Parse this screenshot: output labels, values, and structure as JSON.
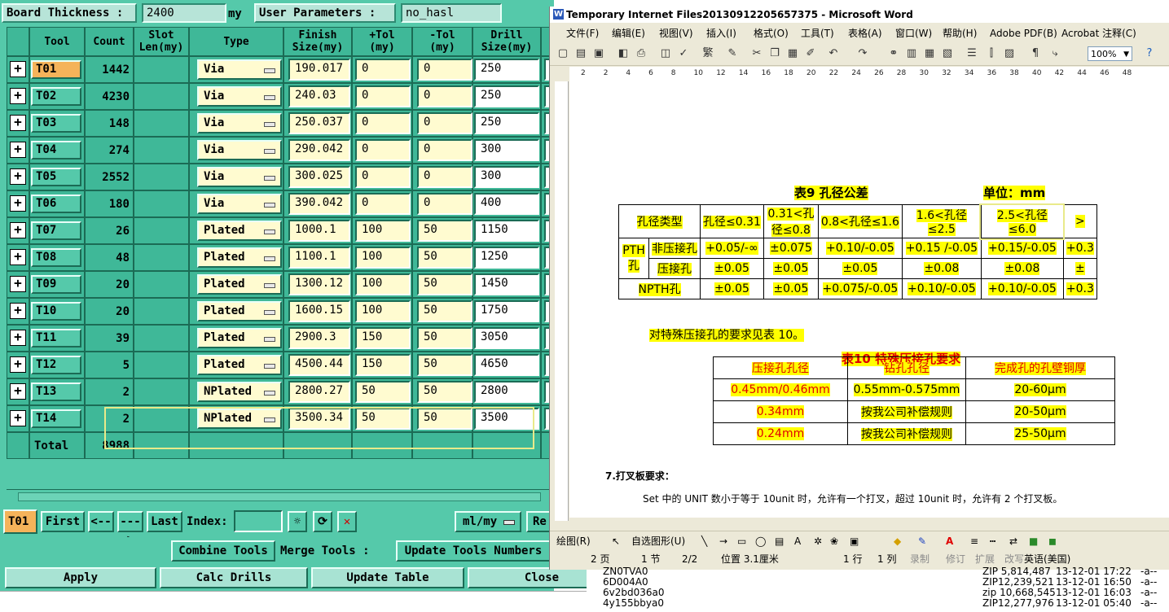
{
  "tool_app": {
    "board_thickness_label": "Board Thickness :",
    "board_thickness_value": "2400",
    "board_thickness_unit": "my",
    "user_params_label": "User Parameters :",
    "user_params_value": "no_hasl",
    "columns": [
      "Tool",
      "Count",
      "Slot\nLen(my)",
      "Type",
      "Finish\nSize(my)",
      "+Tol\n(my)",
      "-Tol\n(my)",
      "Drill\nSize(my)"
    ],
    "rows": [
      {
        "tool": "T01",
        "count": "1442",
        "type": "Via",
        "finish": "190.017",
        "ptol": "0",
        "mtol": "0",
        "drill": "250"
      },
      {
        "tool": "T02",
        "count": "4230",
        "type": "Via",
        "finish": "240.03",
        "ptol": "0",
        "mtol": "0",
        "drill": "250"
      },
      {
        "tool": "T03",
        "count": "148",
        "type": "Via",
        "finish": "250.037",
        "ptol": "0",
        "mtol": "0",
        "drill": "250"
      },
      {
        "tool": "T04",
        "count": "274",
        "type": "Via",
        "finish": "290.042",
        "ptol": "0",
        "mtol": "0",
        "drill": "300"
      },
      {
        "tool": "T05",
        "count": "2552",
        "type": "Via",
        "finish": "300.025",
        "ptol": "0",
        "mtol": "0",
        "drill": "300"
      },
      {
        "tool": "T06",
        "count": "180",
        "type": "Via",
        "finish": "390.042",
        "ptol": "0",
        "mtol": "0",
        "drill": "400"
      },
      {
        "tool": "T07",
        "count": "26",
        "type": "Plated",
        "finish": "1000.1",
        "ptol": "100",
        "mtol": "50",
        "drill": "1150"
      },
      {
        "tool": "T08",
        "count": "48",
        "type": "Plated",
        "finish": "1100.1",
        "ptol": "100",
        "mtol": "50",
        "drill": "1250"
      },
      {
        "tool": "T09",
        "count": "20",
        "type": "Plated",
        "finish": "1300.12",
        "ptol": "100",
        "mtol": "50",
        "drill": "1450"
      },
      {
        "tool": "T10",
        "count": "20",
        "type": "Plated",
        "finish": "1600.15",
        "ptol": "100",
        "mtol": "50",
        "drill": "1750"
      },
      {
        "tool": "T11",
        "count": "39",
        "type": "Plated",
        "finish": "2900.3",
        "ptol": "150",
        "mtol": "50",
        "drill": "3050"
      },
      {
        "tool": "T12",
        "count": "5",
        "type": "Plated",
        "finish": "4500.44",
        "ptol": "150",
        "mtol": "50",
        "drill": "4650"
      },
      {
        "tool": "T13",
        "count": "2",
        "type": "NPlated",
        "finish": "2800.27",
        "ptol": "50",
        "mtol": "50",
        "drill": "2800"
      },
      {
        "tool": "T14",
        "count": "2",
        "type": "NPlated",
        "finish": "3500.34",
        "ptol": "50",
        "mtol": "50",
        "drill": "3500"
      }
    ],
    "total_label": "Total",
    "total_value": "8988",
    "nav": {
      "current_tool": "T01",
      "first": "First",
      "prev": "<---",
      "next": "--->",
      "last": "Last",
      "index_label": "Index:",
      "index_value": "",
      "unit_select": "ml/my",
      "re_label": "Re"
    },
    "combine_tools": "Combine Tools",
    "merge_tools_label": "Merge Tools :",
    "update_tools_numbers": "Update Tools Numbers",
    "apply": "Apply",
    "calc_drills": "Calc Drills",
    "update_table": "Update Table",
    "close": "Close"
  },
  "word": {
    "title": "Temporary Internet Files20130912205657375 - Microsoft Word",
    "menu": [
      "文件(F)",
      "编辑(E)",
      "视图(V)",
      "插入(I)",
      "格式(O)",
      "工具(T)",
      "表格(A)",
      "窗口(W)",
      "帮助(H)",
      "Adobe PDF(B)",
      "Acrobat 注释(C)"
    ],
    "zoom": "100%",
    "ruler_ticks": [
      "2",
      "2",
      "4",
      "6",
      "8",
      "10",
      "12",
      "14",
      "16",
      "18",
      "20",
      "22",
      "24",
      "26",
      "28",
      "30",
      "32",
      "34",
      "36",
      "38",
      "40",
      "42",
      "44",
      "46",
      "48"
    ],
    "table9_title": "表9  孔径公差",
    "table9_unit": "单位：mm",
    "table9": {
      "header": [
        "孔径类型",
        "孔径≤0.31",
        "0.31<孔径≤0.8",
        "0.8<孔径≤1.6",
        "1.6<孔径≤2.5",
        "2.5<孔径≤6.0",
        ">"
      ],
      "pth_label": "PTH孔",
      "row1_label": "非压接孔",
      "row1": [
        "+0.05/-∞",
        "±0.075",
        "+0.10/-0.05",
        "+0.15 /-0.05",
        "+0.15/-0.05",
        "+0.3"
      ],
      "row2_label": "压接孔",
      "row2": [
        "±0.05",
        "±0.05",
        "±0.05",
        "±0.08",
        "±0.08",
        "±"
      ],
      "row3_label": "NPTH孔",
      "row3": [
        "±0.05",
        "±0.05",
        "+0.075/-0.05",
        "+0.10/-0.05",
        "+0.10/-0.05",
        "+0.3"
      ]
    },
    "note": "对特殊压接孔的要求见表 10。",
    "table10_title": "表10  特殊压接孔要求",
    "table10": {
      "header": [
        "压接孔孔径",
        "钻孔孔径",
        "完成孔的孔壁铜厚"
      ],
      "rows": [
        [
          "0.45mm/0.46mm",
          "0.55mm-0.575mm",
          "20-60μm"
        ],
        [
          "0.34mm",
          "按我公司补偿规则",
          "20-50μm"
        ],
        [
          "0.24mm",
          "按我公司补偿规则",
          "25-50μm"
        ]
      ]
    },
    "section_heading": "7.打叉板要求：",
    "section_text": "Set 中的 UNIT 数小于等于 10unit 时，允许有一个打叉，超过 10unit 时，允许有 2 个打叉板。",
    "draw_label": "绘图(R)",
    "autoshape_label": "自选图形(U)",
    "status": [
      "2 页",
      "1 节",
      "2/2",
      "位置 3.1厘米",
      "1 行",
      "1 列",
      "录制",
      "修订",
      "扩展",
      "改写",
      "英语(美国)"
    ]
  },
  "file_list": [
    {
      "name": "ZN0TVA0",
      "info": "ZIP 5,814,487",
      "date": "13-12-01 17:22",
      "attr": "-a--"
    },
    {
      "name": "6D004A0",
      "info": "ZIP12,239,521",
      "date": "13-12-01 16:50",
      "attr": "-a--"
    },
    {
      "name": "6v2bd036a0",
      "info": "zip 10,668,545",
      "date": "13-12-01 16:03",
      "attr": "-a--"
    },
    {
      "name": "4y155bbya0",
      "info": "ZIP12,277,976",
      "date": "13-12-01 05:40",
      "attr": "-a--"
    }
  ],
  "colors": {
    "app_bg": "#55c9aa",
    "header_bg": "#3fb898",
    "input_bg": "#fffbd0",
    "selected_tool": "#f5b35a",
    "highlight": "#ffff00"
  }
}
